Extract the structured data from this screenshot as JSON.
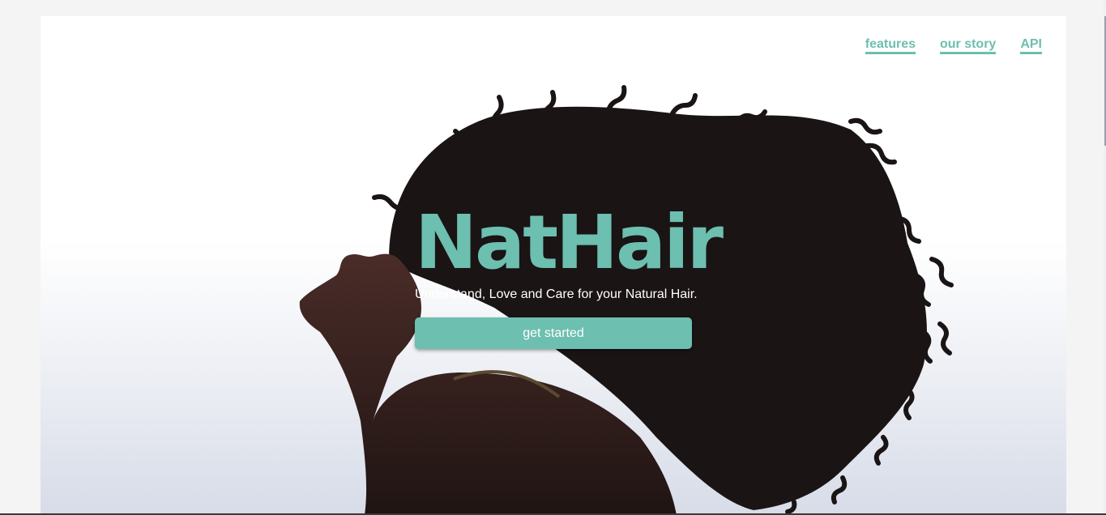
{
  "nav": {
    "items": [
      {
        "label": "features"
      },
      {
        "label": "our story"
      },
      {
        "label": "API"
      }
    ]
  },
  "hero": {
    "title": "NatHair",
    "subtitle": "Understand, Love and Care for your Natural Hair.",
    "cta_label": "get started"
  },
  "colors": {
    "accent": "#6dbfb0",
    "page_background": "#f4f4f4",
    "hair": "#1a1414",
    "skin": "#3a2320"
  }
}
